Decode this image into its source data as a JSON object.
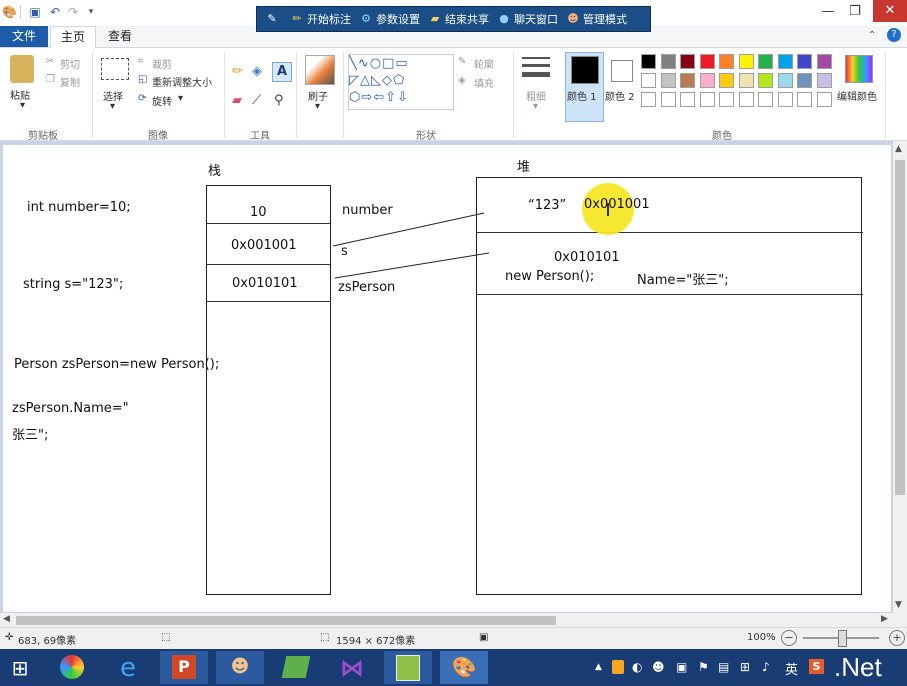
{
  "quick_access": {
    "save_icon": "save-icon",
    "undo_icon": "undo-icon",
    "redo_icon": "redo-icon",
    "customize_icon": "dropdown-arrow-icon"
  },
  "overlay_toolbar": {
    "items": [
      {
        "icon": "pin-icon",
        "label": ""
      },
      {
        "icon": "pen-icon",
        "label": "开始标注"
      },
      {
        "icon": "settings-icon",
        "label": "参数设置"
      },
      {
        "icon": "folder-icon",
        "label": "结束共享"
      },
      {
        "icon": "chat-icon",
        "label": "聊天窗口"
      },
      {
        "icon": "user-icon",
        "label": "管理模式"
      }
    ]
  },
  "tabs": {
    "file": "文件",
    "home": "主页",
    "view": "查看"
  },
  "ribbon": {
    "clipboard": {
      "paste": "粘贴",
      "cut": "剪切",
      "copy": "复制",
      "label": "剪贴板"
    },
    "image": {
      "select": "选择",
      "crop": "裁剪",
      "resize": "重新调整大小",
      "rotate": "旋转",
      "label": "图像"
    },
    "tools": {
      "label": "工具"
    },
    "brush": {
      "label": "刷子"
    },
    "shapes": {
      "outline": "轮廓",
      "fill": "填充",
      "label": "形状"
    },
    "size": {
      "label": "粗细"
    },
    "color1": "颜色 1",
    "color2": "颜色 2",
    "edit_colors": "编辑颜色",
    "colors_label": "颜色",
    "palette_row1": [
      "#000000",
      "#7f7f7f",
      "#880015",
      "#ed1c24",
      "#ff7f27",
      "#fff200",
      "#22b14c",
      "#00a2e8",
      "#3f48cc",
      "#a349a4"
    ],
    "palette_row2": [
      "#ffffff",
      "#c3c3c3",
      "#b97a57",
      "#ffaec9",
      "#ffc90e",
      "#efe4b0",
      "#b5e61d",
      "#99d9ea",
      "#7092be",
      "#c8bfe7"
    ],
    "palette_row3": [
      "#ffffff",
      "#ffffff",
      "#ffffff",
      "#ffffff",
      "#ffffff",
      "#ffffff",
      "#ffffff",
      "#ffffff",
      "#ffffff",
      "#ffffff"
    ],
    "color1_value": "#000000",
    "color2_value": "#ffffff"
  },
  "canvas": {
    "stack_title": "栈",
    "heap_title": "堆",
    "code_int": "int number=10;",
    "code_string": "string s=\"123\";",
    "code_person": "Person zsPerson=new Person();",
    "code_name_1": "zsPerson.Name=\"",
    "code_name_2": "张三\";",
    "stack_cell_1": "10",
    "stack_cell_2": "0x001001",
    "stack_cell_3": "0x010101",
    "var_number": "number",
    "var_s": "s",
    "var_zsperson": "zsPerson",
    "heap_string_value": "“123”",
    "heap_string_addr": "0x001001",
    "heap_obj_addr": "0x010101",
    "heap_obj_new": "new Person();",
    "heap_obj_name": "Name=\"张三\";"
  },
  "status": {
    "cursor_pos": "683, 69像素",
    "image_size": "1594 × 672像素",
    "zoom": "100%"
  },
  "taskbar": {
    "tray_lang": "英",
    "tray_brand": ".Net"
  }
}
